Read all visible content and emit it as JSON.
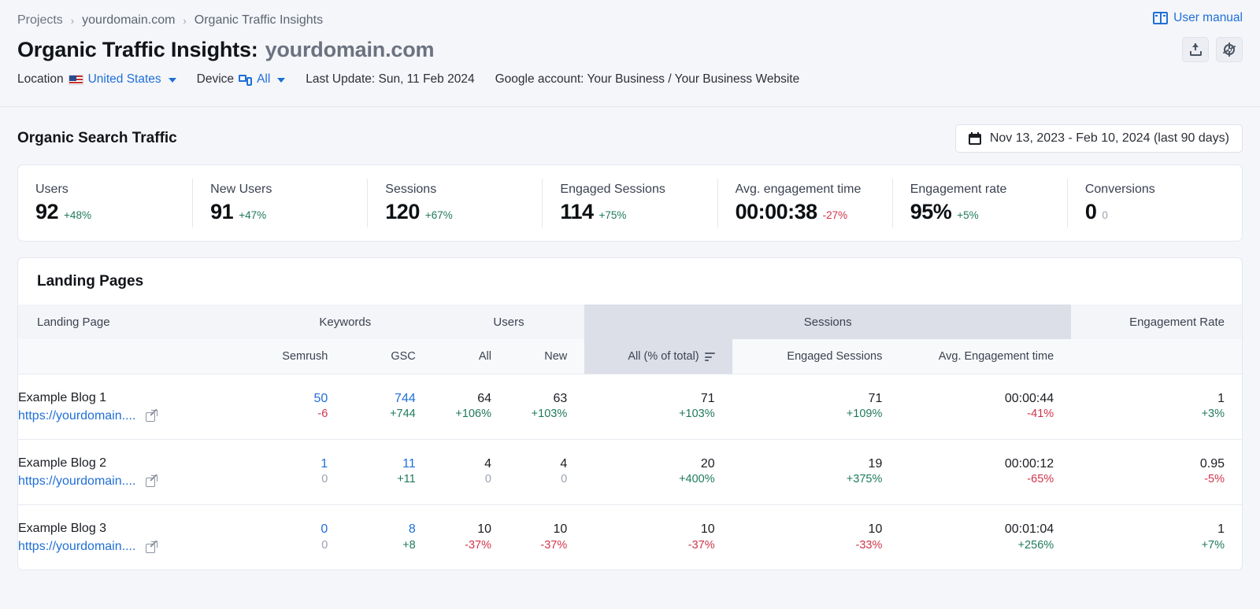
{
  "breadcrumb": {
    "items": [
      "Projects",
      "yourdomain.com",
      "Organic Traffic Insights"
    ],
    "separator": "›"
  },
  "header": {
    "title_main": "Organic Traffic Insights:",
    "title_domain": "yourdomain.com",
    "user_manual": "User manual",
    "user_manual_icon": "book-icon",
    "export_icon": "upload-icon",
    "settings_icon": "gear-icon",
    "meta": {
      "location_label": "Location",
      "location_value": "United States",
      "location_icon": "us-flag-icon",
      "device_label": "Device",
      "device_value": "All",
      "device_icon": "devices-icon",
      "last_update": "Last Update: Sun, 11 Feb 2024",
      "google_account": "Google account: Your Business / Your Business Website"
    }
  },
  "section": {
    "title": "Organic Search Traffic",
    "date_range": "Nov 13, 2023 - Feb 10, 2024 (last 90 days)",
    "date_icon": "calendar-icon"
  },
  "metrics": [
    {
      "label": "Users",
      "value": "92",
      "delta": "+48%",
      "dir": "up"
    },
    {
      "label": "New Users",
      "value": "91",
      "delta": "+47%",
      "dir": "up"
    },
    {
      "label": "Sessions",
      "value": "120",
      "delta": "+67%",
      "dir": "up"
    },
    {
      "label": "Engaged Sessions",
      "value": "114",
      "delta": "+75%",
      "dir": "up"
    },
    {
      "label": "Avg. engagement time",
      "value": "00:00:38",
      "delta": "-27%",
      "dir": "down"
    },
    {
      "label": "Engagement rate",
      "value": "95%",
      "delta": "+5%",
      "dir": "up"
    },
    {
      "label": "Conversions",
      "value": "0",
      "delta": "0",
      "dir": "neutral"
    }
  ],
  "landing_pages": {
    "title": "Landing Pages",
    "group_headers": {
      "landing_page": "Landing Page",
      "keywords": "Keywords",
      "users": "Users",
      "sessions": "Sessions",
      "engagement_rate": "Engagement Rate"
    },
    "sub_headers": {
      "semrush": "Semrush",
      "gsc": "GSC",
      "users_all": "All",
      "users_new": "New",
      "sessions_all": "All (% of total)",
      "sessions_all_sort_icon": "sort-descending-icon",
      "engaged_sessions": "Engaged Sessions",
      "avg_engagement_time": "Avg. Engagement time"
    },
    "rows": [
      {
        "name": "Example Blog 1",
        "url": "https://yourdomain....",
        "link_icon": "external-link-icon",
        "semrush": {
          "value": "50",
          "delta": "-6",
          "vdir": "link",
          "ddir": "down"
        },
        "gsc": {
          "value": "744",
          "delta": "+744",
          "vdir": "link",
          "ddir": "up"
        },
        "users_all": {
          "value": "64",
          "delta": "+106%",
          "vdir": "plain",
          "ddir": "up"
        },
        "users_new": {
          "value": "63",
          "delta": "+103%",
          "vdir": "plain",
          "ddir": "up"
        },
        "sessions_all": {
          "value": "71",
          "delta": "+103%",
          "vdir": "plain",
          "ddir": "up"
        },
        "engaged": {
          "value": "71",
          "delta": "+109%",
          "vdir": "plain",
          "ddir": "up"
        },
        "avg_time": {
          "value": "00:00:44",
          "delta": "-41%",
          "vdir": "plain",
          "ddir": "down"
        },
        "eng_rate": {
          "value": "1",
          "delta": "+3%",
          "vdir": "plain",
          "ddir": "up"
        }
      },
      {
        "name": "Example Blog 2",
        "url": "https://yourdomain....",
        "link_icon": "external-link-icon",
        "semrush": {
          "value": "1",
          "delta": "0",
          "vdir": "link",
          "ddir": "neutral"
        },
        "gsc": {
          "value": "11",
          "delta": "+11",
          "vdir": "link",
          "ddir": "up"
        },
        "users_all": {
          "value": "4",
          "delta": "0",
          "vdir": "plain",
          "ddir": "neutral"
        },
        "users_new": {
          "value": "4",
          "delta": "0",
          "vdir": "plain",
          "ddir": "neutral"
        },
        "sessions_all": {
          "value": "20",
          "delta": "+400%",
          "vdir": "plain",
          "ddir": "up"
        },
        "engaged": {
          "value": "19",
          "delta": "+375%",
          "vdir": "plain",
          "ddir": "up"
        },
        "avg_time": {
          "value": "00:00:12",
          "delta": "-65%",
          "vdir": "plain",
          "ddir": "down"
        },
        "eng_rate": {
          "value": "0.95",
          "delta": "-5%",
          "vdir": "plain",
          "ddir": "down"
        }
      },
      {
        "name": "Example Blog 3",
        "url": "https://yourdomain....",
        "link_icon": "external-link-icon",
        "semrush": {
          "value": "0",
          "delta": "0",
          "vdir": "link",
          "ddir": "neutral"
        },
        "gsc": {
          "value": "8",
          "delta": "+8",
          "vdir": "link",
          "ddir": "up"
        },
        "users_all": {
          "value": "10",
          "delta": "-37%",
          "vdir": "plain",
          "ddir": "down"
        },
        "users_new": {
          "value": "10",
          "delta": "-37%",
          "vdir": "plain",
          "ddir": "down"
        },
        "sessions_all": {
          "value": "10",
          "delta": "-37%",
          "vdir": "plain",
          "ddir": "down"
        },
        "engaged": {
          "value": "10",
          "delta": "-33%",
          "vdir": "plain",
          "ddir": "down"
        },
        "avg_time": {
          "value": "00:01:04",
          "delta": "+256%",
          "vdir": "plain",
          "ddir": "up"
        },
        "eng_rate": {
          "value": "1",
          "delta": "+7%",
          "vdir": "plain",
          "ddir": "up"
        }
      }
    ]
  },
  "colors": {
    "link": "#1f6fd6",
    "positive": "#1f7a5a",
    "negative": "#d1344b",
    "neutral": "#9aa2af",
    "highlight": "#dcdee8"
  }
}
